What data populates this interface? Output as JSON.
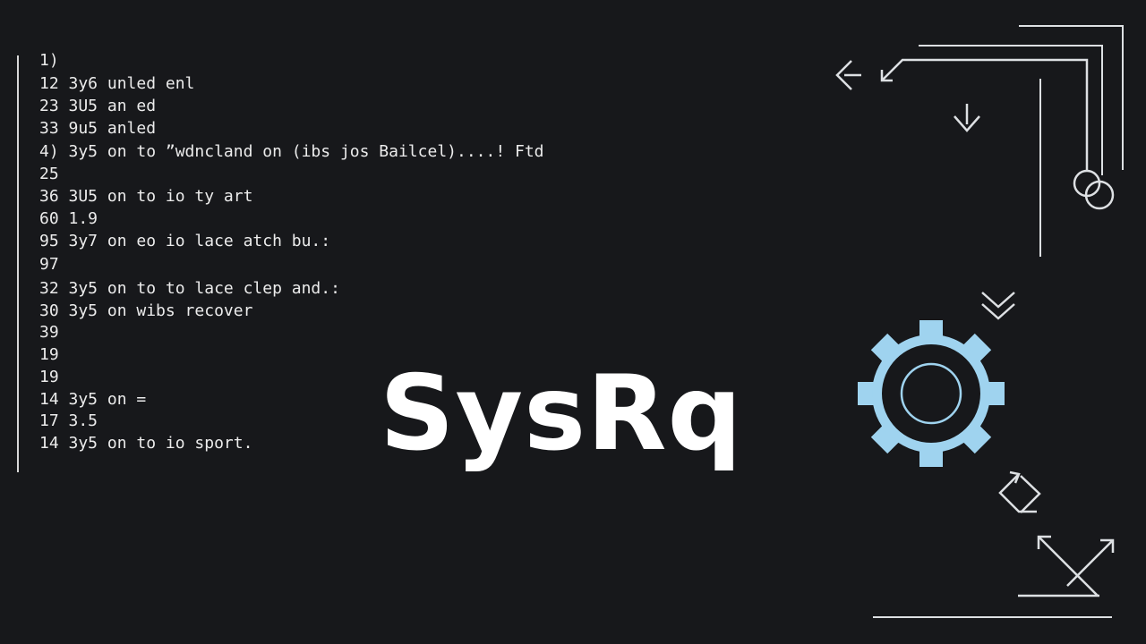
{
  "log": {
    "lines": [
      "1)",
      "12 3y6 unled enl",
      "23 3U5 an ed",
      "33 9u5 anled",
      "4) 3y5 on to ”wdncland on (ibs jos Bailcel)....! Ftd",
      "25",
      "36 3U5 on to io ty art",
      "60 1.9",
      "95 3y7 on eo io lace atch bu.:",
      "97",
      "32 3y5 on to to lace clep and.:",
      "30 3y5 on wibs recover",
      "39",
      "19",
      "19",
      "14 3y5 on =",
      "17 3.5",
      "14 3y5 on to io sport."
    ]
  },
  "headline": {
    "text": "SysRq"
  },
  "icons": {
    "back": "arrow-left-icon",
    "corner": "arrow-up-left-icon",
    "download": "download-icon",
    "rings": "linked-rings-icon",
    "chevrons": "double-chevron-down-icon",
    "gear": "gear-icon",
    "cycle": "cycle-arrows-icon",
    "expand": "crossed-arrows-icon"
  },
  "colors": {
    "background": "#17181b",
    "text": "#ececec",
    "accent": "#9fd3ef",
    "stroke": "#dde0e3"
  }
}
